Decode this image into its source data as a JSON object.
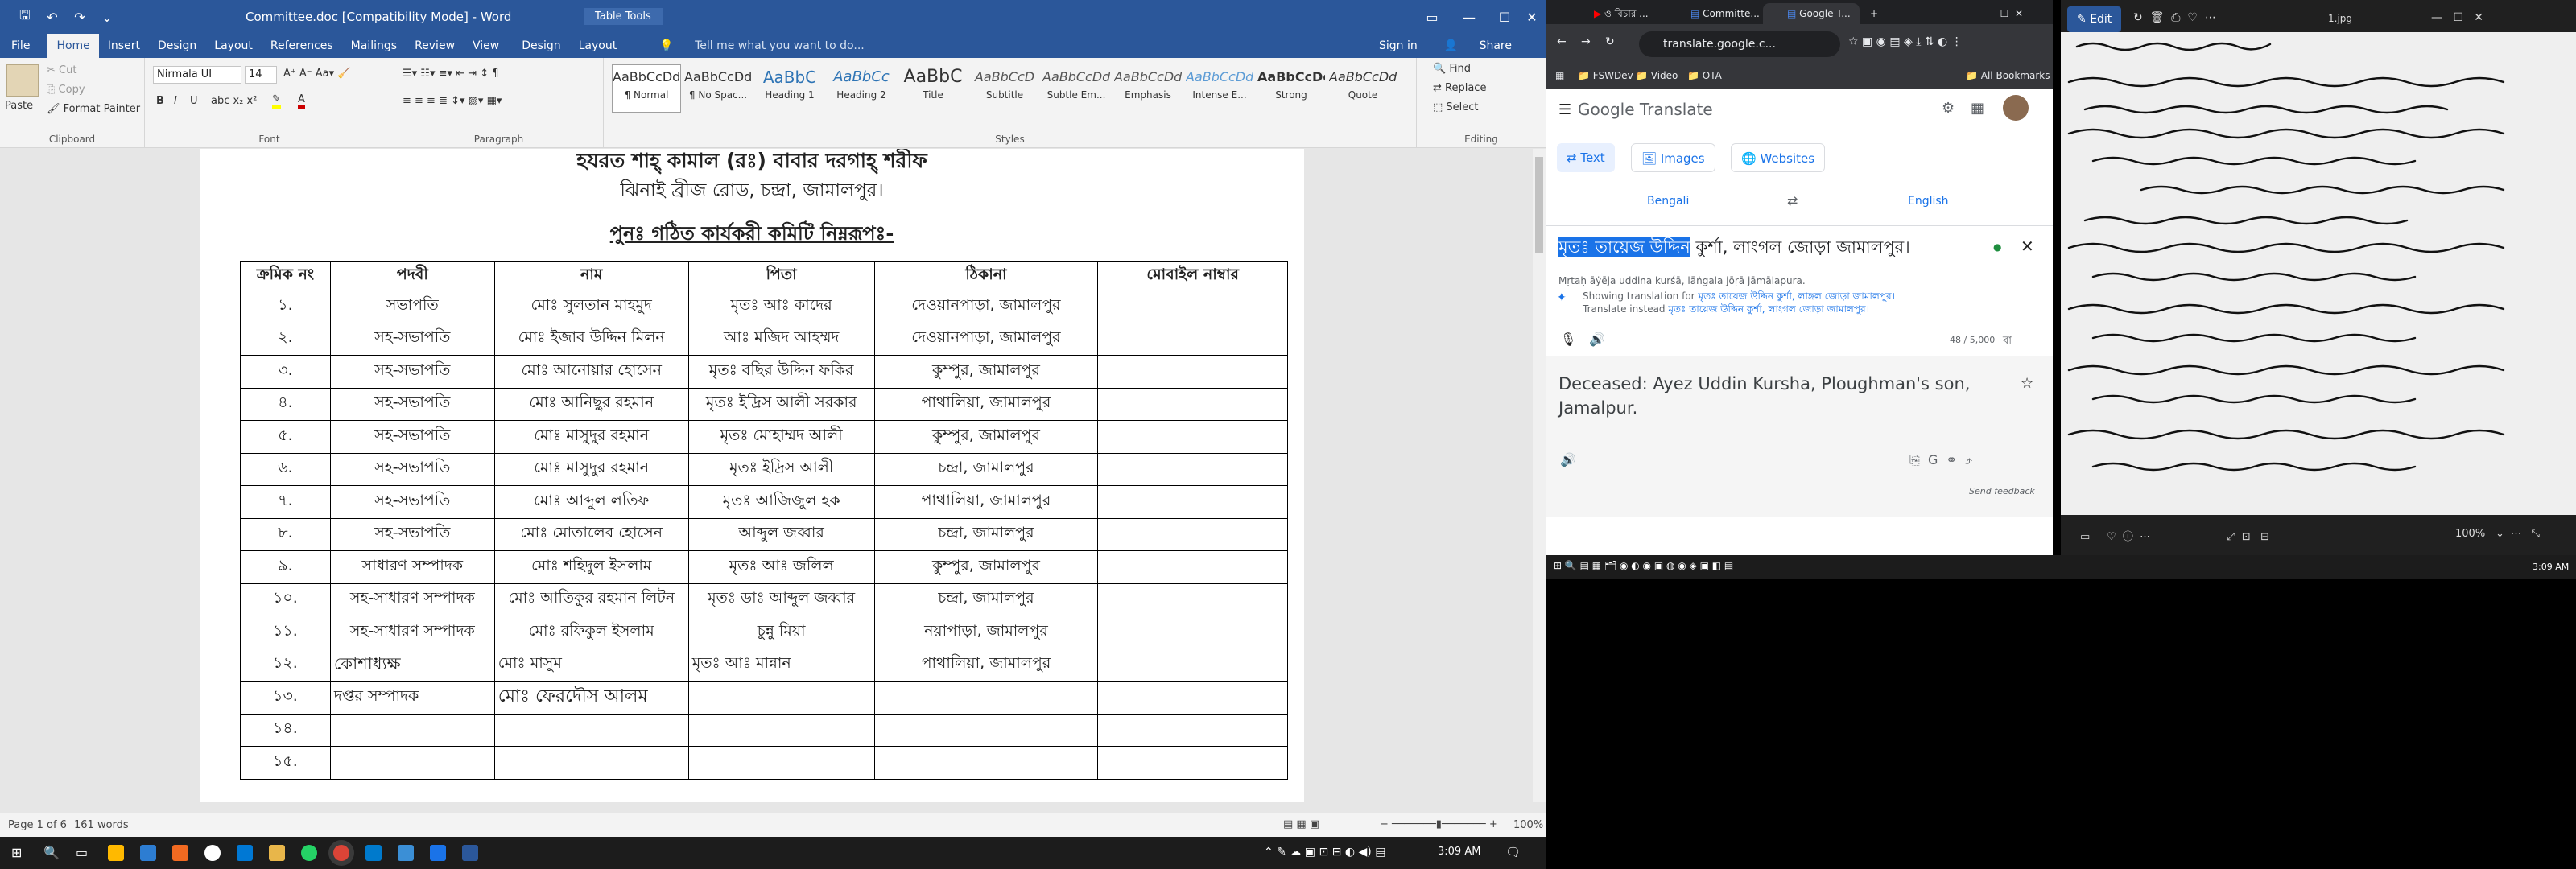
{
  "word": {
    "title_doc": "Committee.doc [Compatibility Mode] - Word",
    "title_tools": "Table Tools",
    "signin": "Sign in",
    "share": "Share",
    "tabs": [
      "File",
      "Home",
      "Insert",
      "Design",
      "Layout",
      "References",
      "Mailings",
      "Review",
      "View",
      "Design",
      "Layout"
    ],
    "tell_me": "Tell me what you want to do...",
    "clipboard": {
      "paste": "Paste",
      "cut": "Cut",
      "copy": "Copy",
      "format_painter": "Format Painter",
      "label": "Clipboard"
    },
    "font": {
      "name": "Nirmala UI",
      "size": "14",
      "label": "Font"
    },
    "paragraph_label": "Paragraph",
    "styles": [
      {
        "preview": "AaBbCcDd",
        "name": "¶ Normal"
      },
      {
        "preview": "AaBbCcDd",
        "name": "¶ No Spac..."
      },
      {
        "preview": "AaBbC",
        "name": "Heading 1"
      },
      {
        "preview": "AaBbCc",
        "name": "Heading 2"
      },
      {
        "preview": "AaBbC",
        "name": "Title"
      },
      {
        "preview": "AaBbCcD",
        "name": "Subtitle"
      },
      {
        "preview": "AaBbCcDd",
        "name": "Subtle Em..."
      },
      {
        "preview": "AaBbCcDd",
        "name": "Emphasis"
      },
      {
        "preview": "AaBbCcDd",
        "name": "Intense E..."
      },
      {
        "preview": "AaBbCcDc",
        "name": "Strong"
      },
      {
        "preview": "AaBbCcDd",
        "name": "Quote"
      }
    ],
    "styles_label": "Styles",
    "editing": {
      "find": "Find",
      "replace": "Replace",
      "select": "Select",
      "label": "Editing"
    },
    "doc": {
      "line1": "হযরত শাহ্ কামাল (রঃ) বাবার দরগাহ্ শরীফ",
      "line2": "ঝিনাই ব্রীজ রোড, চন্দ্রা, জামালপুর।",
      "line3": "পুনঃ গঠিত কার্যকরী কমিটি নিম্নরূপঃ-",
      "headers": [
        "ক্রমিক নং",
        "পদবী",
        "নাম",
        "পিতা",
        "ঠিকানা",
        "মোবাইল নাম্বার"
      ],
      "rows": [
        [
          "১.",
          "সভাপতি",
          "মোঃ সুলতান মাহমুদ",
          "মৃতঃ আঃ কাদের",
          "দেওয়ানপাড়া, জামালপুর",
          ""
        ],
        [
          "২.",
          "সহ-সভাপতি",
          "মোঃ ইজাব উদ্দিন মিলন",
          "আঃ মজিদ আহম্মদ",
          "দেওয়ানপাড়া, জামালপুর",
          ""
        ],
        [
          "৩.",
          "সহ-সভাপতি",
          "মোঃ আনোয়ার হোসেন",
          "মৃতঃ বছির উদ্দিন ফকির",
          "কুম্পুর, জামালপুর",
          ""
        ],
        [
          "৪.",
          "সহ-সভাপতি",
          "মোঃ আনিছুর রহমান",
          "মৃতঃ ইদ্রিস আলী সরকার",
          "পাথালিয়া, জামালপুর",
          ""
        ],
        [
          "৫.",
          "সহ-সভাপতি",
          "মোঃ মাসুদুর রহমান",
          "মৃতঃ মোহাম্মদ আলী",
          "কুম্পুর, জামালপুর",
          ""
        ],
        [
          "৬.",
          "সহ-সভাপতি",
          "মোঃ মাসুদুর রহমান",
          "মৃতঃ ইদ্রিস আলী",
          "চন্দ্রা, জামালপুর",
          ""
        ],
        [
          "৭.",
          "সহ-সভাপতি",
          "মোঃ আব্দুল লতিফ",
          "মৃতঃ আজিজুল হক",
          "পাথালিয়া, জামালপুর",
          ""
        ],
        [
          "৮.",
          "সহ-সভাপতি",
          "মোঃ মোতালেব হোসেন",
          "আব্দুল জব্বার",
          "চন্দ্রা, জামালপুর",
          ""
        ],
        [
          "৯.",
          "সাধারণ সম্পাদক",
          "মোঃ শহিদুল ইসলাম",
          "মৃতঃ আঃ জলিল",
          "কুম্পুর, জামালপুর",
          ""
        ],
        [
          "১০.",
          "সহ-সাধারণ সম্পাদক",
          "মোঃ আতিকুর রহমান লিটন",
          "মৃতঃ ডাঃ আব্দুল জব্বার",
          "চন্দ্রা, জামালপুর",
          ""
        ],
        [
          "১১.",
          "সহ-সাধারণ সম্পাদক",
          "মোঃ রফিকুল ইসলাম",
          "চুন্নু মিয়া",
          "নয়াপাড়া, জামালপুর",
          ""
        ],
        [
          "১২.",
          "কোশাধ্যক্ষ",
          "মোঃ মাসুম",
          "মৃতঃ আঃ মান্নান",
          "পাথালিয়া, জামালপুর",
          ""
        ],
        [
          "১৩.",
          "দপ্তর সম্পাদক",
          "মোঃ ফেরদৌস আলম",
          "",
          "",
          ""
        ],
        [
          "১৪.",
          "",
          "",
          "",
          "",
          ""
        ],
        [
          "১৫.",
          "",
          "",
          "",
          "",
          ""
        ]
      ]
    },
    "status": {
      "page": "Page 1 of 6",
      "words": "161 words",
      "zoom": "100%"
    }
  },
  "chrome": {
    "tabs": [
      "ও বিচার ...",
      "Committe...",
      "Google T..."
    ],
    "url": "translate.google.c...",
    "bookmarks": [
      "FSWDev",
      "Video",
      "OTA"
    ],
    "all_bookmarks": "All Bookmarks",
    "gt": {
      "brand": "Google Translate",
      "modes": [
        "Text",
        "Images",
        "Websites"
      ],
      "src_lang": "Bengali",
      "tgt_lang": "English",
      "src_highlight": "মৃতঃ তায়েজ উদ্দিন",
      "src_rest": " কুর্শা, লাংগল জোড়া  জামালপুর।",
      "translit": "Mṛtaḥ āẏēja uddina kurśā, lāṅgala jōṛā jāmālapura.",
      "showing_prefix": "Showing translation for ",
      "showing_text": "মৃতঃ তায়েজ উদ্দিন কুর্শা, লাঙ্গল জোড়া জামালপুর।",
      "instead_prefix": "Translate instead ",
      "instead_text": "মৃতঃ তায়েজ উদ্দিন কুর্শা, লাংগল জোড়া জামালপুর।",
      "count": "48 / 5,000",
      "kbd": "বা",
      "output": "Deceased: Ayez Uddin Kursha, Ploughman's son, Jamalpur.",
      "feedback": "Send feedback"
    }
  },
  "viewer": {
    "file": "1.jpg",
    "edit": "Edit",
    "zoom": "100%"
  },
  "clock_small": "3:09 AM",
  "clock_main": "3:09 AM",
  "colors": {
    "word_blue": "#2b579a",
    "gt_blue": "#1a73e8",
    "selection": "#1a73e8"
  }
}
